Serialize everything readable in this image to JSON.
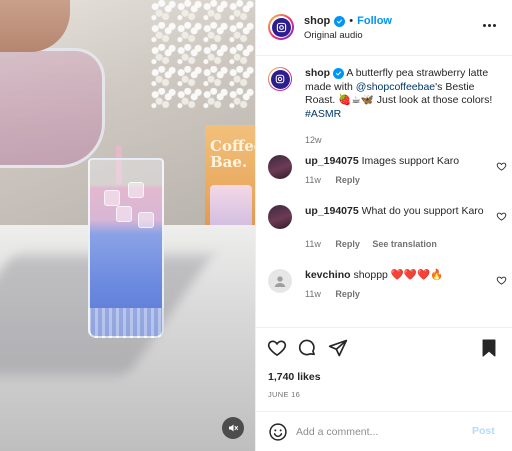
{
  "post": {
    "username": "shop",
    "follow_label": "Follow",
    "separator": "•",
    "audio_label": "Original audio",
    "more_icon": "more-horizontal-icon"
  },
  "caption": {
    "username": "shop",
    "text_before": "A butterfly pea strawberry latte made with",
    "mention": "@shopcoffeebae",
    "text_after": "'s Bestie Roast.",
    "emoji": "🍓☕🦋",
    "text_end": "Just look at those colors!",
    "hashtag": "#ASMR",
    "age": "12w"
  },
  "comments": [
    {
      "username": "up_194075",
      "text": "Images support Karo",
      "age": "11w",
      "reply_label": "Reply"
    },
    {
      "username": "up_194075",
      "text": "What do you support Karo",
      "age": "11w",
      "reply_label": "Reply",
      "translate_label": "See translation"
    },
    {
      "username": "kevchino",
      "text": "shoppp ❤️❤️❤️🔥",
      "age": "11w",
      "reply_label": "Reply"
    }
  ],
  "actions": {
    "likes": "1,740 likes",
    "date": "JUNE 16",
    "comment_placeholder": "Add a comment...",
    "post_label": "Post"
  },
  "media": {
    "box_label": "Coffee Bae."
  },
  "colors": {
    "accent": "#0095f6",
    "text": "#262626",
    "muted": "#737373",
    "post_disabled": "#b3dbff"
  }
}
